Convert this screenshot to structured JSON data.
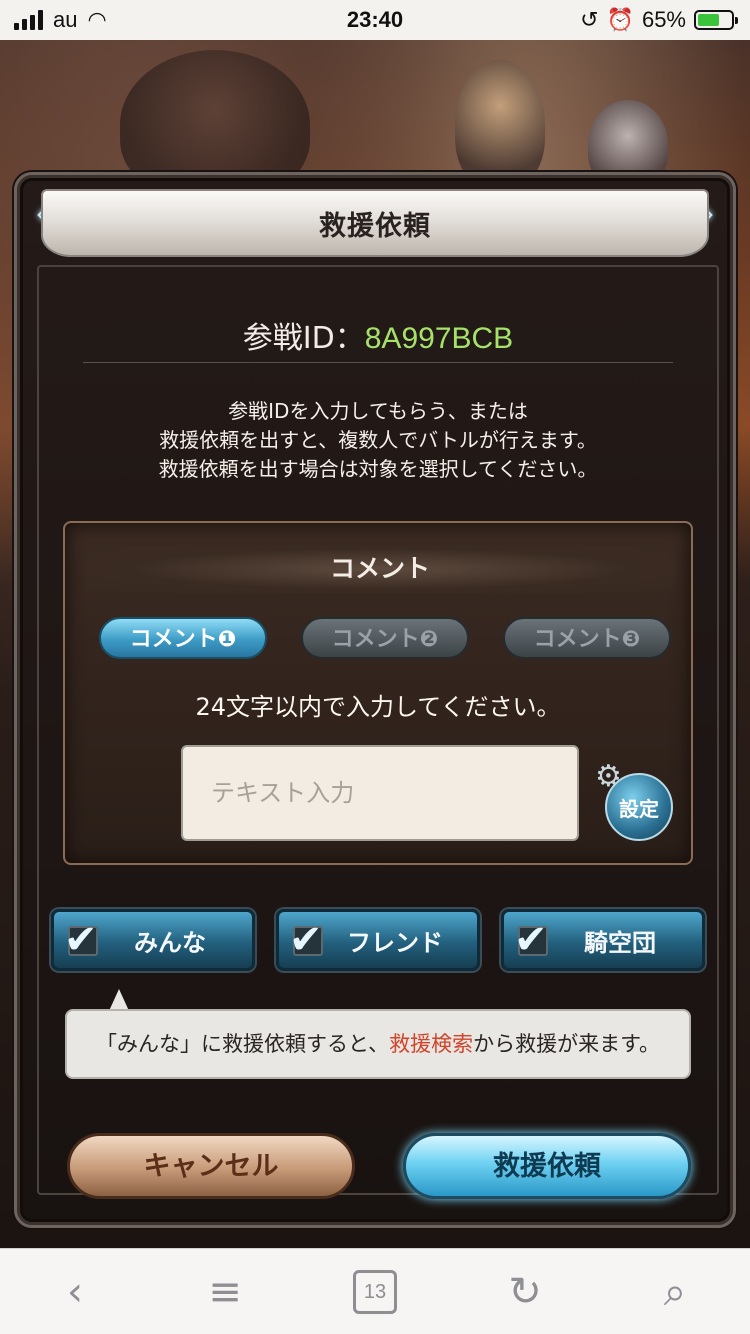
{
  "status_bar": {
    "carrier": "au",
    "time": "23:40",
    "battery_percent": "65%",
    "battery_level": 0.65
  },
  "dialog": {
    "title": "救援依頼",
    "battle_id_label": "参戦ID：",
    "battle_id_value": "8A997BCB",
    "description_lines": [
      "参戦IDを入力してもらう、または",
      "救援依頼を出すと、複数人でバトルが行えます。",
      "救援依頼を出す場合は対象を選択してください。"
    ],
    "comment": {
      "header": "コメント",
      "tabs": [
        {
          "label": "コメント❶",
          "active": true
        },
        {
          "label": "コメント❷",
          "active": false
        },
        {
          "label": "コメント❸",
          "active": false
        }
      ],
      "hint": "24文字以内で入力してください。",
      "input_placeholder": "テキスト入力",
      "input_value": "",
      "settings_label": "設定"
    },
    "targets": [
      {
        "label": "みんな",
        "checked": true
      },
      {
        "label": "フレンド",
        "checked": true
      },
      {
        "label": "騎空団",
        "checked": true
      }
    ],
    "tip": {
      "before": "「みんな」に救援依頼すると、",
      "highlight": "救援検索",
      "after": "から救援が来ます。"
    },
    "buttons": {
      "cancel": "キャンセル",
      "submit": "救援依頼"
    }
  },
  "browser_toolbar": {
    "tab_count": "13"
  },
  "colors": {
    "battle_id_value": "#a6e26a",
    "tip_highlight": "#d1442a",
    "active_tab": "#3d9cc6"
  }
}
